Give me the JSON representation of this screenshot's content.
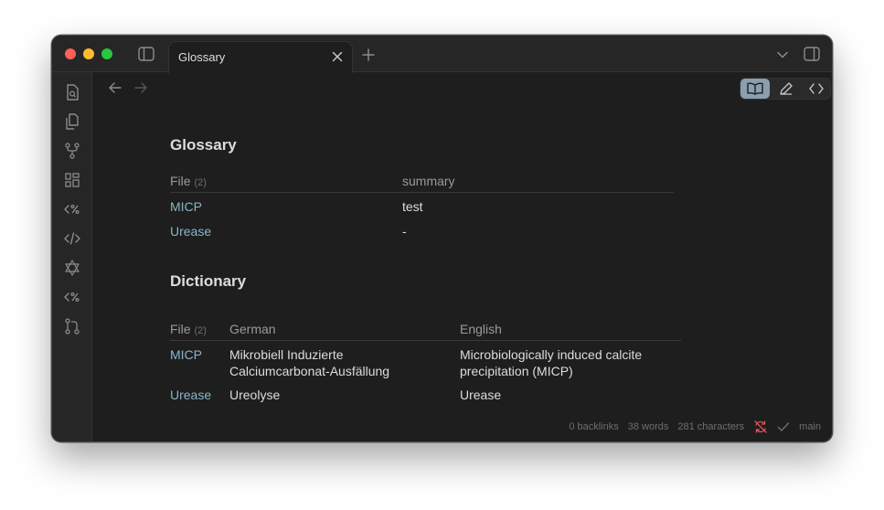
{
  "tab": {
    "title": "Glossary"
  },
  "glossary": {
    "title": "Glossary",
    "headers": {
      "file": "File",
      "file_count": "(2)",
      "summary": "summary"
    },
    "rows": [
      {
        "file": "MICP",
        "summary": "test"
      },
      {
        "file": "Urease",
        "summary": "-"
      }
    ]
  },
  "dictionary": {
    "title": "Dictionary",
    "headers": {
      "file": "File",
      "file_count": "(2)",
      "german": "German",
      "english": "English"
    },
    "rows": [
      {
        "file": "MICP",
        "german_line1": "Mikrobiell Induzierte",
        "german_line2": "Calciumcarbonat-Ausfällung",
        "english_line1": "Microbiologically induced calcite",
        "english_line2": "precipitation (MICP)"
      },
      {
        "file": "Urease",
        "german_line1": "Ureolyse",
        "english_line1": "Urease"
      }
    ]
  },
  "status": {
    "backlinks": "0 backlinks",
    "words": "38 words",
    "characters": "281 characters",
    "branch": "main"
  },
  "colors": {
    "link": "#8ab4c9",
    "active_view": "#8a9fb0",
    "sync_error": "#e0505a"
  }
}
